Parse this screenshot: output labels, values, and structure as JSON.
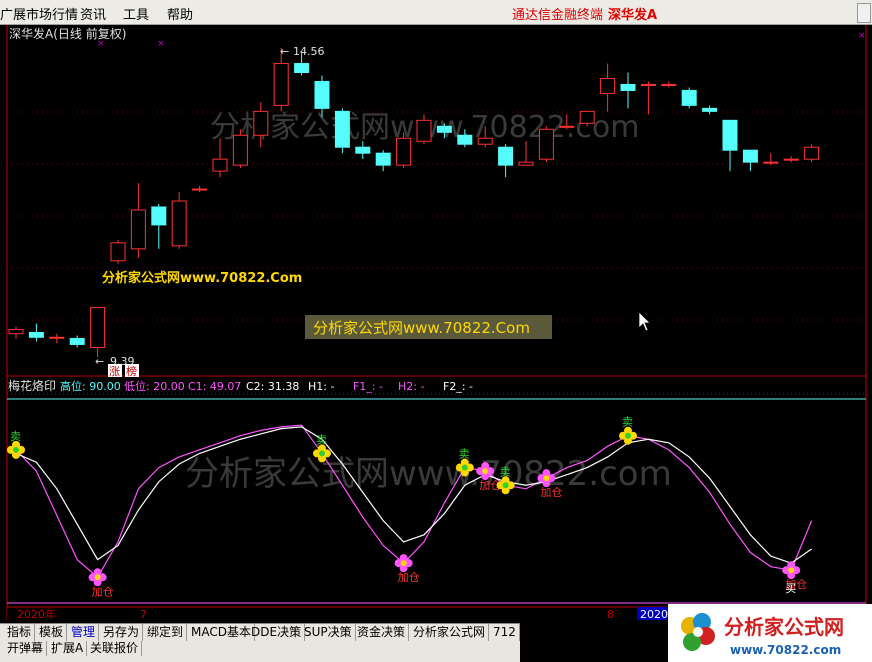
{
  "menu": {
    "items": [
      "广展市场行情",
      "资讯",
      "工具",
      "帮助"
    ],
    "right_links": [
      "通达信金融终端",
      "深华发A"
    ]
  },
  "main_chart": {
    "title": "深华发A(日线 前复权)",
    "high_label": "14.56",
    "low_label": "9.39",
    "tags": [
      "涨",
      "榜"
    ],
    "up_color": "#ff3232",
    "down_color": "#54fcfc",
    "candles": [
      {
        "o": 9.78,
        "c": 9.85,
        "h": 9.9,
        "l": 9.7
      },
      {
        "o": 9.8,
        "c": 9.72,
        "h": 9.95,
        "l": 9.65
      },
      {
        "o": 9.72,
        "c": 9.72,
        "h": 9.78,
        "l": 9.62
      },
      {
        "o": 9.7,
        "c": 9.6,
        "h": 9.75,
        "l": 9.55
      },
      {
        "o": 9.55,
        "c": 10.22,
        "h": 10.22,
        "l": 9.39
      },
      {
        "o": 11.0,
        "c": 11.3,
        "h": 11.35,
        "l": 10.95
      },
      {
        "o": 11.2,
        "c": 11.85,
        "h": 12.3,
        "l": 11.05
      },
      {
        "o": 11.9,
        "c": 11.6,
        "h": 11.95,
        "l": 11.2
      },
      {
        "o": 11.25,
        "c": 12.0,
        "h": 12.15,
        "l": 11.2
      },
      {
        "o": 12.2,
        "c": 12.2,
        "h": 12.25,
        "l": 12.15
      },
      {
        "o": 12.5,
        "c": 12.7,
        "h": 13.05,
        "l": 12.4
      },
      {
        "o": 12.6,
        "c": 13.1,
        "h": 13.2,
        "l": 12.55
      },
      {
        "o": 13.1,
        "c": 13.5,
        "h": 13.65,
        "l": 12.9
      },
      {
        "o": 13.6,
        "c": 14.3,
        "h": 14.56,
        "l": 13.5
      },
      {
        "o": 14.3,
        "c": 14.15,
        "h": 14.5,
        "l": 14.1
      },
      {
        "o": 14.0,
        "c": 13.55,
        "h": 14.1,
        "l": 13.4
      },
      {
        "o": 13.5,
        "c": 12.9,
        "h": 13.55,
        "l": 12.8
      },
      {
        "o": 12.9,
        "c": 12.8,
        "h": 13.0,
        "l": 12.7
      },
      {
        "o": 12.8,
        "c": 12.6,
        "h": 12.85,
        "l": 12.5
      },
      {
        "o": 12.6,
        "c": 13.05,
        "h": 13.15,
        "l": 12.55
      },
      {
        "o": 13.0,
        "c": 13.35,
        "h": 13.45,
        "l": 12.95
      },
      {
        "o": 13.25,
        "c": 13.15,
        "h": 13.3,
        "l": 13.05
      },
      {
        "o": 13.1,
        "c": 12.95,
        "h": 13.2,
        "l": 12.9
      },
      {
        "o": 12.95,
        "c": 13.05,
        "h": 13.25,
        "l": 12.9
      },
      {
        "o": 12.9,
        "c": 12.6,
        "h": 12.95,
        "l": 12.4
      },
      {
        "o": 12.6,
        "c": 12.65,
        "h": 13.0,
        "l": 12.6
      },
      {
        "o": 12.7,
        "c": 13.2,
        "h": 13.25,
        "l": 12.65
      },
      {
        "o": 13.25,
        "c": 13.25,
        "h": 13.45,
        "l": 13.2
      },
      {
        "o": 13.3,
        "c": 13.5,
        "h": 13.5,
        "l": 13.25
      },
      {
        "o": 13.8,
        "c": 14.05,
        "h": 14.3,
        "l": 13.5
      },
      {
        "o": 13.95,
        "c": 13.85,
        "h": 14.15,
        "l": 13.55
      },
      {
        "o": 13.95,
        "c": 13.95,
        "h": 14.0,
        "l": 13.45
      },
      {
        "o": 13.95,
        "c": 13.95,
        "h": 14.0,
        "l": 13.9
      },
      {
        "o": 13.85,
        "c": 13.6,
        "h": 13.9,
        "l": 13.55
      },
      {
        "o": 13.55,
        "c": 13.5,
        "h": 13.6,
        "l": 13.45
      },
      {
        "o": 13.35,
        "c": 12.85,
        "h": 13.35,
        "l": 12.5
      },
      {
        "o": 12.85,
        "c": 12.65,
        "h": 12.85,
        "l": 12.5
      },
      {
        "o": 12.65,
        "c": 12.65,
        "h": 12.8,
        "l": 12.6
      },
      {
        "o": 12.7,
        "c": 12.7,
        "h": 12.75,
        "l": 12.65
      },
      {
        "o": 12.7,
        "c": 12.9,
        "h": 12.95,
        "l": 12.65
      }
    ],
    "watermark_yellow": "分析家公式网www.70822.Com",
    "watermark_box": "分析家公式网www.70822.Com",
    "watermark_gray": "分析家公式网www.70822.com"
  },
  "indicator": {
    "name": "梅花烙印",
    "labels": [
      {
        "key": "高位:",
        "value": "90.00",
        "color": "#54fcfc"
      },
      {
        "key": "低位:",
        "value": "20.00",
        "color": "#ff54ff"
      },
      {
        "key": "C1:",
        "value": "49.07",
        "color": "#ff54ff"
      },
      {
        "key": "C2:",
        "value": "31.38",
        "color": "#ffffff"
      },
      {
        "key": "H1:",
        "value": "-",
        "color": "#ffffff"
      },
      {
        "key": "F1_:",
        "value": "-",
        "color": "#ff54ff"
      },
      {
        "key": "H2:",
        "value": "-",
        "color": "#ff54ff"
      },
      {
        "key": "F2_:",
        "value": "-",
        "color": "#ffffff"
      }
    ],
    "ylim": [
      0,
      100
    ],
    "c1_values": [
      82,
      70,
      45,
      20,
      10,
      30,
      60,
      72,
      78,
      82,
      86,
      90,
      93,
      95,
      96,
      80,
      62,
      44,
      28,
      18,
      30,
      52,
      72,
      70,
      62,
      60,
      66,
      72,
      76,
      84,
      90,
      88,
      82,
      72,
      58,
      40,
      24,
      16,
      14,
      42
    ],
    "c2_values": [
      80,
      75,
      60,
      40,
      20,
      28,
      48,
      64,
      74,
      80,
      84,
      88,
      91,
      94,
      95,
      88,
      74,
      58,
      42,
      30,
      34,
      46,
      62,
      68,
      64,
      62,
      64,
      68,
      72,
      78,
      86,
      88,
      86,
      78,
      66,
      50,
      34,
      22,
      18,
      26
    ],
    "signals": [
      "卖",
      "加仓",
      "卖",
      "加仓",
      "卖",
      "加仓",
      "卖",
      "加仓",
      "卖",
      "加仓",
      "买"
    ],
    "watermark_gray": "分析家公式网www.70822.com"
  },
  "xaxis": {
    "labels": [
      "2020年",
      "7",
      "8",
      "2020/08/04"
    ]
  },
  "tabs": [
    "指标",
    "模板",
    "管理",
    "另存为",
    "绑定到",
    "MACD基本",
    "DDE决策",
    "SUP决策",
    "资金决策",
    "分析家公式网",
    "712"
  ],
  "bottom_tabs": [
    "开弹幕",
    "扩展A",
    "关联报价"
  ],
  "logo": {
    "text": "分析家公式网",
    "url": "www.70822.com"
  }
}
